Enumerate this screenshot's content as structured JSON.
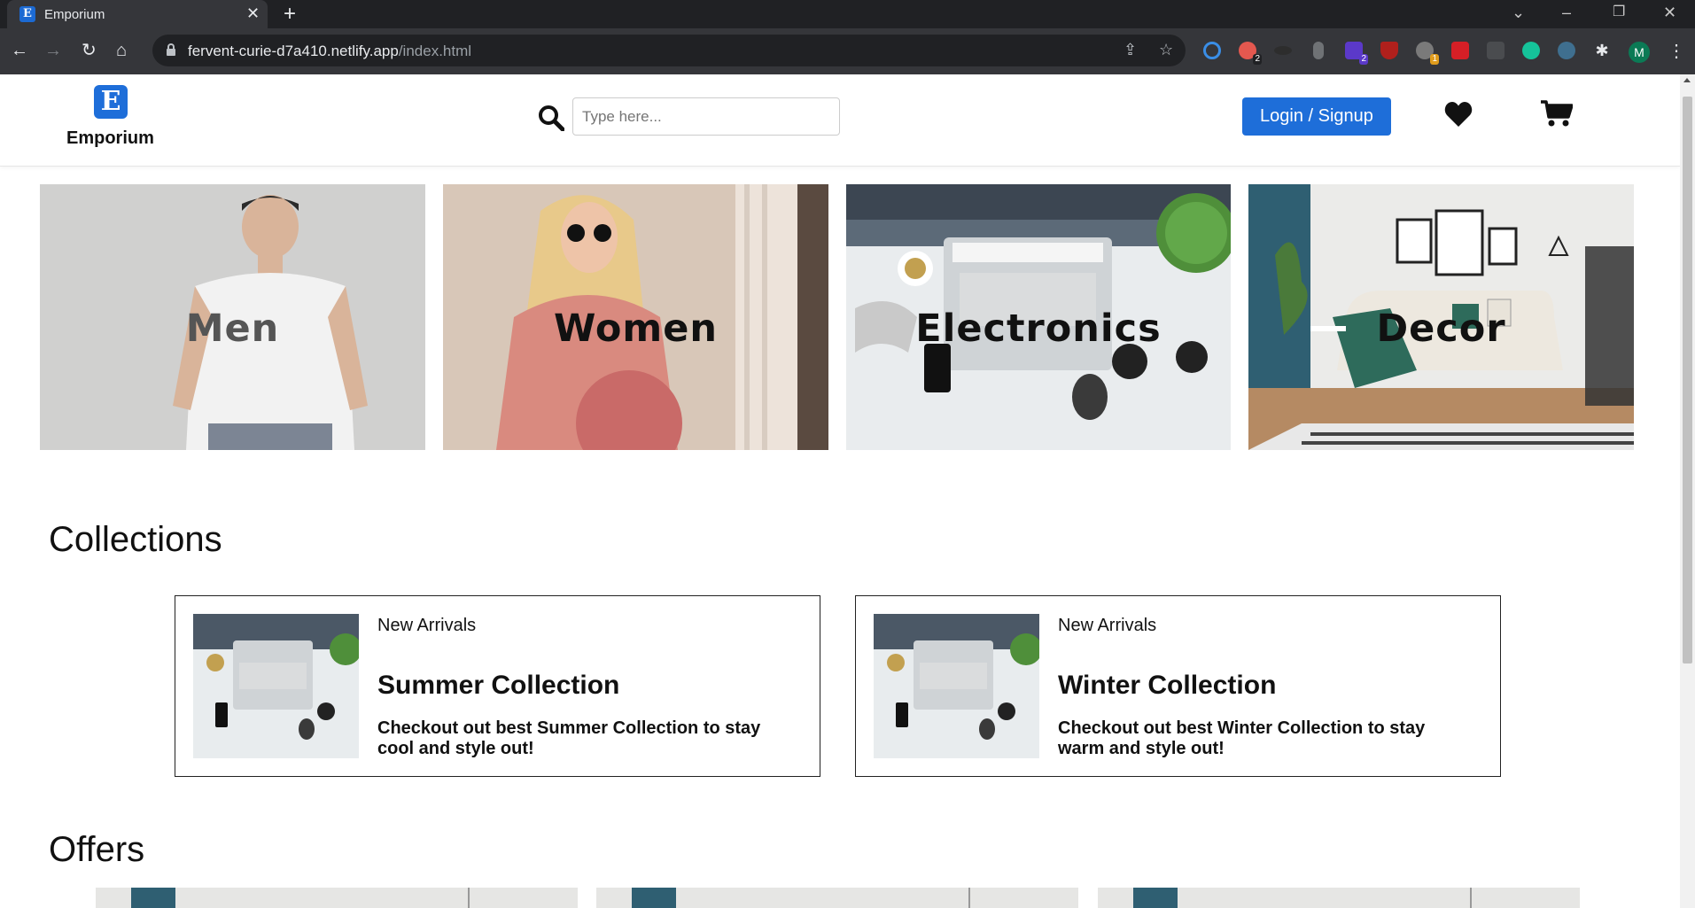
{
  "browser": {
    "tab_title": "Emporium",
    "favicon_letter": "E",
    "url_host": "fervent-curie-d7a410.netlify.app",
    "url_path": "/index.html",
    "extension_badges": [
      "2",
      "2",
      "1"
    ],
    "profile_initial": "M"
  },
  "header": {
    "logo_letter": "E",
    "brand": "Emporium",
    "search_placeholder": "Type here...",
    "login_label": "Login / Signup"
  },
  "categories": [
    {
      "label": "Men"
    },
    {
      "label": "Women"
    },
    {
      "label": "Electronics"
    },
    {
      "label": "Decor"
    }
  ],
  "collections": {
    "title": "Collections",
    "items": [
      {
        "kicker": "New Arrivals",
        "title": "Summer Collection",
        "desc": "Checkout out best Summer Collection to stay cool and style out!"
      },
      {
        "kicker": "New Arrivals",
        "title": "Winter Collection",
        "desc": "Checkout out best Winter Collection to stay warm and style out!"
      }
    ]
  },
  "offers": {
    "title": "Offers"
  },
  "colors": {
    "brand_blue": "#1e6ed9",
    "chrome_dark": "#202124",
    "chrome_toolbar": "#35363a"
  }
}
